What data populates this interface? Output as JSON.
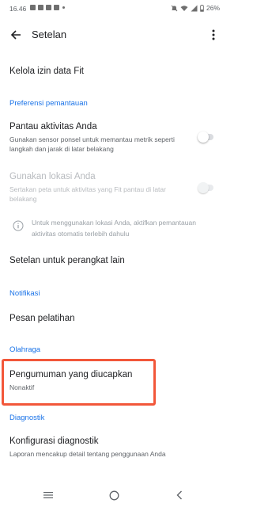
{
  "status_bar": {
    "time": "16.46",
    "battery": "26%"
  },
  "app_bar": {
    "title": "Setelan"
  },
  "items": {
    "fit_data": {
      "title": "Kelola izin data Fit"
    },
    "track_activity": {
      "title": "Pantau aktivitas Anda",
      "subtitle": "Gunakan sensor ponsel untuk memantau metrik seperti langkah dan jarak di latar belakang",
      "toggle_on": false
    },
    "use_location": {
      "title": "Gunakan lokasi Anda",
      "subtitle": "Sertakan peta untuk aktivitas yang Fit pantau di latar belakang",
      "toggle_on": false,
      "disabled": true
    },
    "location_info": {
      "text": "Untuk menggunakan lokasi Anda, aktifkan pemantauan aktivitas otomatis terlebih dahulu"
    },
    "other_devices": {
      "title": "Setelan untuk perangkat lain"
    },
    "coaching": {
      "title": "Pesan pelatihan"
    },
    "spoken_announcements": {
      "title": "Pengumuman yang diucapkan",
      "subtitle": "Nonaktif"
    },
    "diagnostic_config": {
      "title": "Konfigurasi diagnostik",
      "subtitle": "Laporan mencakup detail tentang penggunaan Anda"
    }
  },
  "sections": {
    "monitoring": "Preferensi pemantauan",
    "notifications": "Notifikasi",
    "sports": "Olahraga",
    "diagnostics": "Diagnostik"
  },
  "colors": {
    "accent": "#1a73e8",
    "highlight": "#f2573a"
  }
}
